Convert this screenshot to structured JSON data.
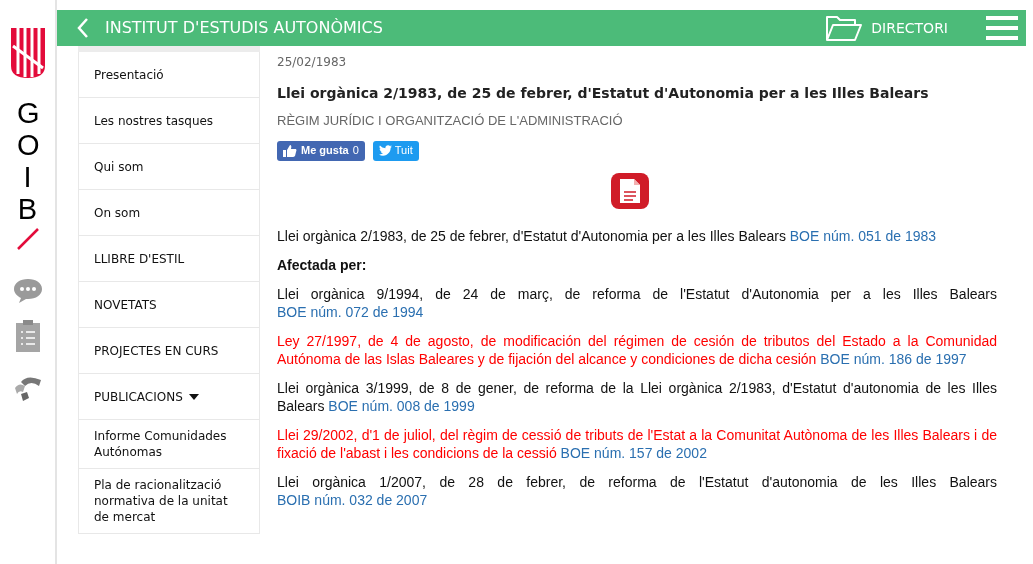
{
  "brand": {
    "wordmark": "GOIB"
  },
  "header": {
    "title": "INSTITUT D'ESTUDIS AUTONÒMICS",
    "directory_label": "DIRECTORI"
  },
  "sidebar": {
    "items": [
      {
        "label": "Presentació",
        "dropdown": false
      },
      {
        "label": "Les nostres tasques",
        "dropdown": false
      },
      {
        "label": "Qui som",
        "dropdown": false
      },
      {
        "label": "On som",
        "dropdown": false
      },
      {
        "label": "LLIBRE D'ESTIL",
        "dropdown": false
      },
      {
        "label": "NOVETATS",
        "dropdown": false
      },
      {
        "label": "PROJECTES EN CURS",
        "dropdown": false
      },
      {
        "label": "PUBLICACIONS",
        "dropdown": true
      },
      {
        "label": "Informe Comunidades Autónomas",
        "dropdown": false
      },
      {
        "label": "Pla de racionalització normativa de la unitat de mercat",
        "dropdown": false
      }
    ]
  },
  "article": {
    "date": "25/02/1983",
    "title": "Llei orgànica 2/1983, de 25 de febrer, d'Estatut d'Autonomia per a les Illes Balears",
    "category": "RÈGIM JURÍDIC I ORGANITZACIÓ DE L'ADMINISTRACIÓ",
    "like_button": "Me gusta",
    "like_count": "0",
    "tweet_button": "Tuit",
    "main_law": {
      "text": "Llei orgànica 2/1983, de 25 de febrer, d'Estatut d'Autonomia per a les Illes Balears",
      "link": "BOE núm. 051 de 1983"
    },
    "affected_heading": "Afectada per:",
    "amendments": [
      {
        "text": "Llei orgànica 9/1994, de 24 de març, de reforma de l'Estatut d'Autonomia per a les Illes Balears",
        "link": "BOE núm. 072 de 1994",
        "color": "#111111"
      },
      {
        "text": "Ley 27/1997, de 4 de agosto, de modificación del régimen de cesión de tributos del Estado a la Comunidad Autónoma de las Islas Baleares y de fijación del alcance y condiciones de dicha cesión",
        "link": "BOE núm. 186 de 1997",
        "color": "#ff0000"
      },
      {
        "text": "Llei orgànica 3/1999, de 8 de gener, de reforma de la Llei orgànica 2/1983, d'Estatut d'autonomia de les Illes Balears",
        "link": "BOE núm. 008 de 1999",
        "color": "#111111"
      },
      {
        "text": "Llei 29/2002, d'1 de juliol, del règim de cessió de tributs de l'Estat a la Comunitat Autònoma de les Illes Balears i de fixació de l'abast i les condicions de la cessió",
        "link": "BOE núm. 157 de 2002",
        "color": "#ff0000"
      },
      {
        "text": "Llei orgànica 1/2007, de 28 de febrer, de reforma de l'Estatut d'autonomia de les Illes Balears",
        "link": "BOIB núm. 032 de 2007",
        "color": "#111111"
      }
    ]
  }
}
